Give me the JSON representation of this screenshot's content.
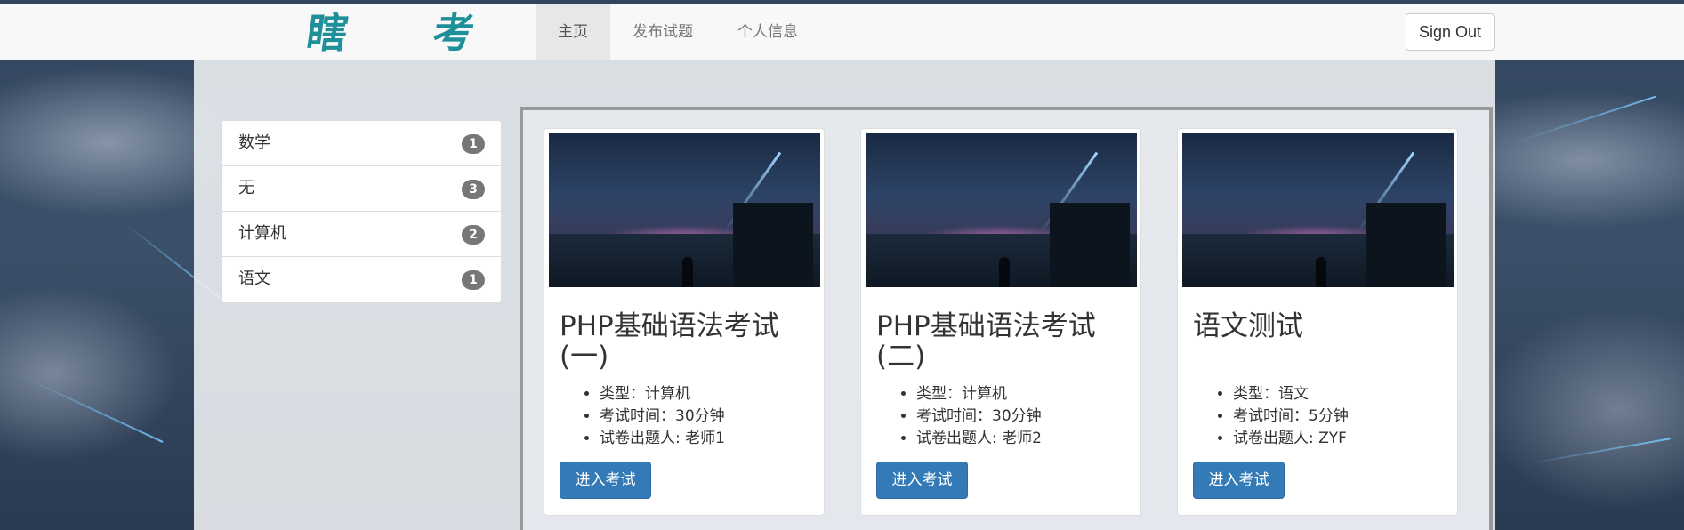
{
  "header": {
    "brand": "瞎 考",
    "nav": [
      {
        "label": "主页",
        "active": true
      },
      {
        "label": "发布试题",
        "active": false
      },
      {
        "label": "个人信息",
        "active": false
      }
    ],
    "sign_out": "Sign Out"
  },
  "categories": [
    {
      "label": "数学",
      "count": "1"
    },
    {
      "label": "无",
      "count": "3"
    },
    {
      "label": "计算机",
      "count": "2"
    },
    {
      "label": "语文",
      "count": "1"
    }
  ],
  "exams": [
    {
      "title": "PHP基础语法考试(一)",
      "type": "类型：计算机",
      "time": "考试时间：30分钟",
      "author": "试卷出题人: 老师1",
      "button": "进入考试"
    },
    {
      "title": "PHP基础语法考试(二)",
      "type": "类型：计算机",
      "time": "考试时间：30分钟",
      "author": "试卷出题人: 老师2",
      "button": "进入考试"
    },
    {
      "title": "语文测试",
      "type": "类型：语文",
      "time": "考试时间：5分钟",
      "author": "试卷出题人: ZYF",
      "button": "进入考试"
    }
  ],
  "colors": {
    "primary": "#337ab7",
    "brand": "#1f8f9a",
    "badge": "#777777",
    "navbar": "#f8f8f8"
  }
}
